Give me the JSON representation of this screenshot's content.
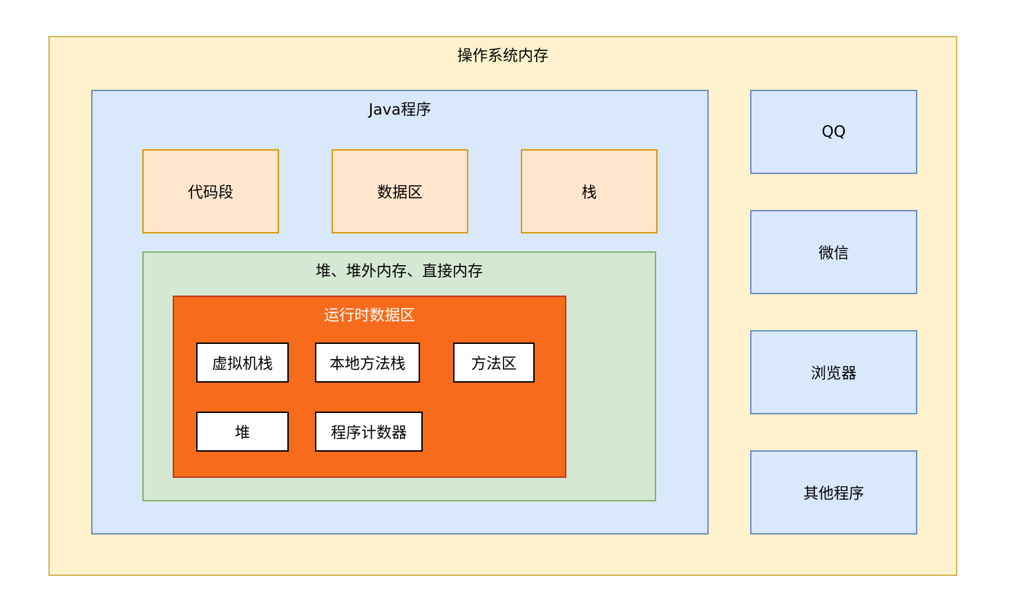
{
  "diagram": {
    "os_memory": {
      "label": "操作系统内存",
      "fill": "#fff2cc",
      "stroke": "#d6b656"
    },
    "java_program": {
      "label": "Java程序",
      "fill": "#dae8fc",
      "stroke": "#6c8ebf",
      "segments": [
        {
          "label": "代码段"
        },
        {
          "label": "数据区"
        },
        {
          "label": "栈"
        }
      ],
      "heap_memory": {
        "label": "堆、堆外内存、直接内存",
        "fill": "#d5e8d4",
        "stroke": "#82b366",
        "runtime_data_area": {
          "label": "运行时数据区",
          "fill": "#f76b1c",
          "stroke": "#c0391d",
          "items": [
            {
              "label": "虚拟机栈"
            },
            {
              "label": "本地方法栈"
            },
            {
              "label": "方法区"
            },
            {
              "label": "堆"
            },
            {
              "label": "程序计数器"
            }
          ]
        }
      }
    },
    "other_apps": [
      {
        "label": "QQ"
      },
      {
        "label": "微信"
      },
      {
        "label": "浏览器"
      },
      {
        "label": "其他程序"
      }
    ]
  }
}
